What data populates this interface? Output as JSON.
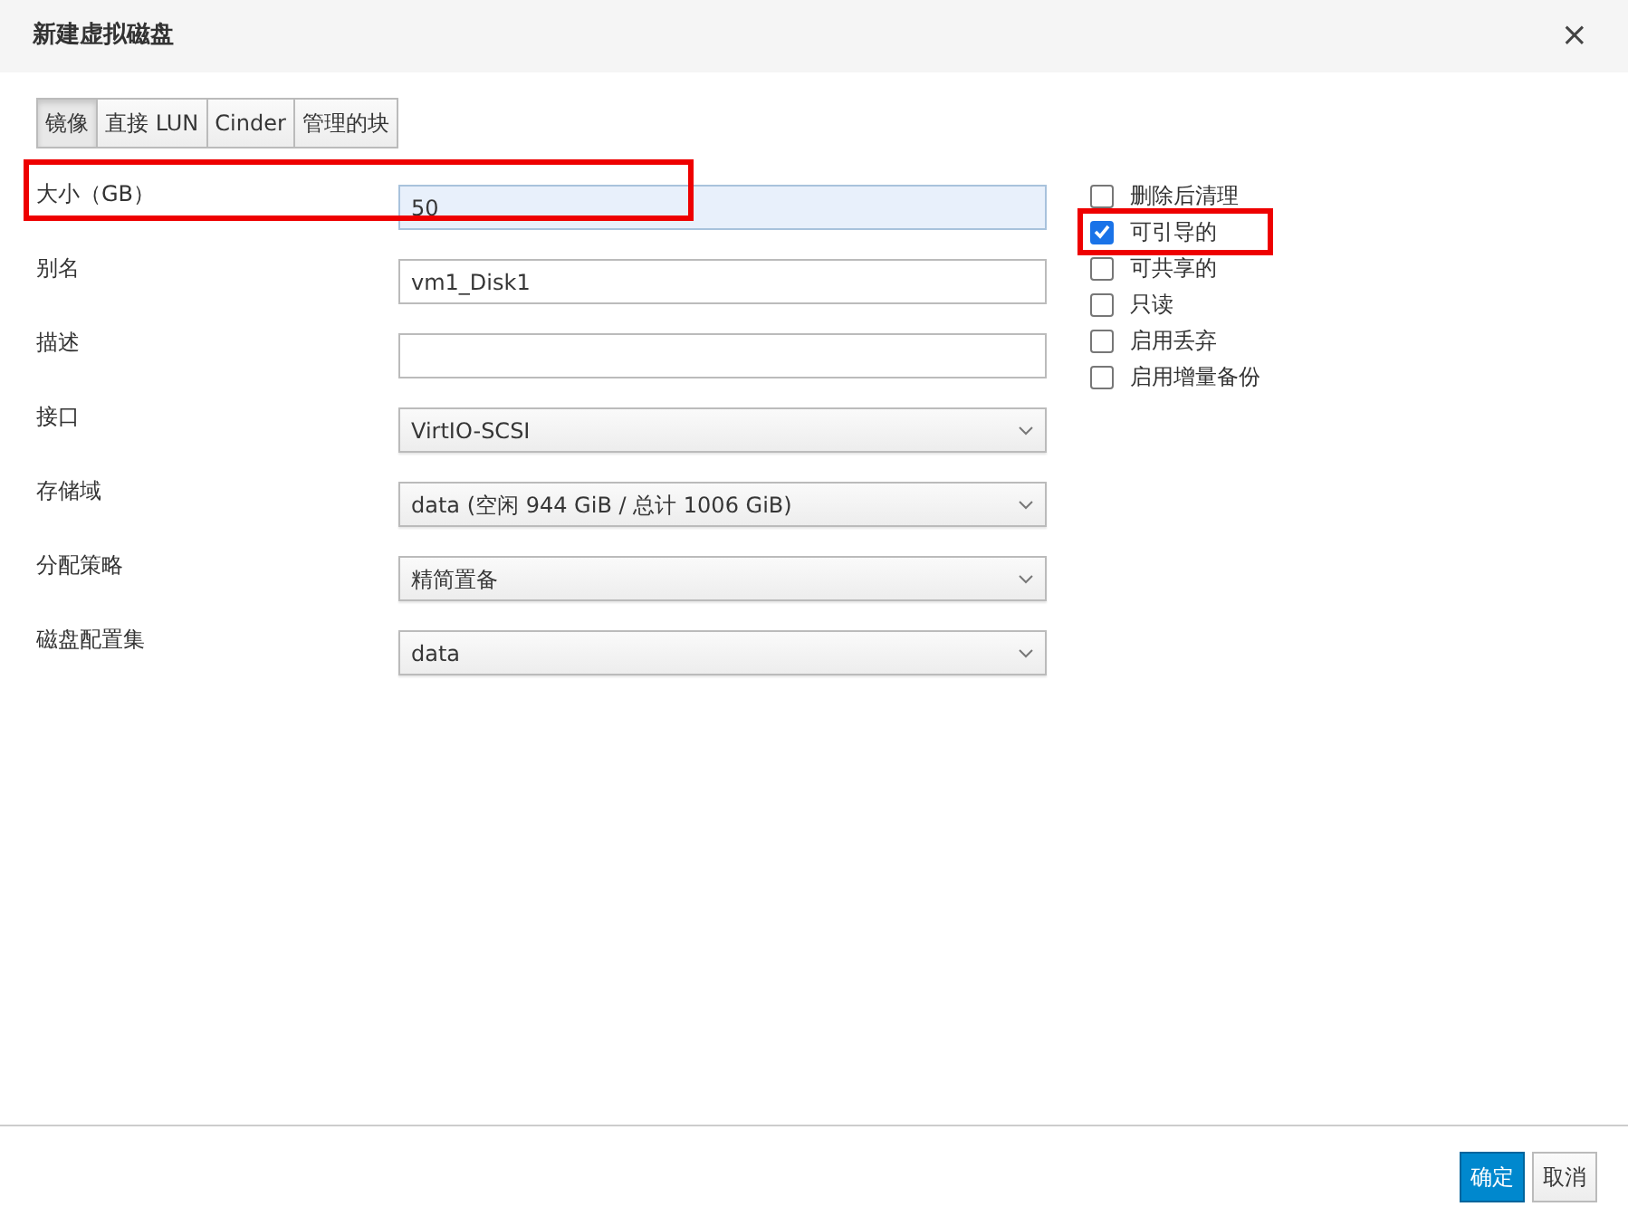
{
  "dialog": {
    "title": "新建虚拟磁盘",
    "close": "×"
  },
  "tabs": [
    {
      "label": "镜像",
      "selected": true
    },
    {
      "label": "直接 LUN",
      "selected": false
    },
    {
      "label": "Cinder",
      "selected": false
    },
    {
      "label": "管理的块",
      "selected": false
    }
  ],
  "fields": [
    {
      "label": "大小（GB）",
      "kind": "input",
      "value": "50",
      "focused": true,
      "highlighted": true
    },
    {
      "label": "别名",
      "kind": "input",
      "value": "vm1_Disk1",
      "focused": false,
      "highlighted": false
    },
    {
      "label": "描述",
      "kind": "input",
      "focused": false,
      "highlighted": false
    },
    {
      "label": "接口",
      "kind": "select",
      "value": "VirtIO-SCSI",
      "highlighted": false
    },
    {
      "label": "存储域",
      "kind": "select",
      "value": "data (空闲 944 GiB / 总计 1006 GiB)",
      "highlighted": false
    },
    {
      "label": "分配策略",
      "kind": "select",
      "value": "精简置备",
      "highlighted": false
    },
    {
      "label": "磁盘配置集",
      "kind": "select",
      "value": "data",
      "highlighted": false
    }
  ],
  "options": [
    {
      "label": "删除后清理",
      "checked": false,
      "highlighted": false
    },
    {
      "label": "可引导的",
      "checked": true,
      "highlighted": true
    },
    {
      "label": "可共享的",
      "checked": false,
      "highlighted": false
    },
    {
      "label": "只读",
      "checked": false,
      "highlighted": false
    },
    {
      "label": "启用丢弃",
      "checked": false,
      "highlighted": false
    },
    {
      "label": "启用增量备份",
      "checked": false,
      "highlighted": false
    }
  ],
  "buttons": [
    {
      "label": "确定",
      "kind": "primary"
    },
    {
      "label": "取消",
      "kind": "default"
    }
  ]
}
